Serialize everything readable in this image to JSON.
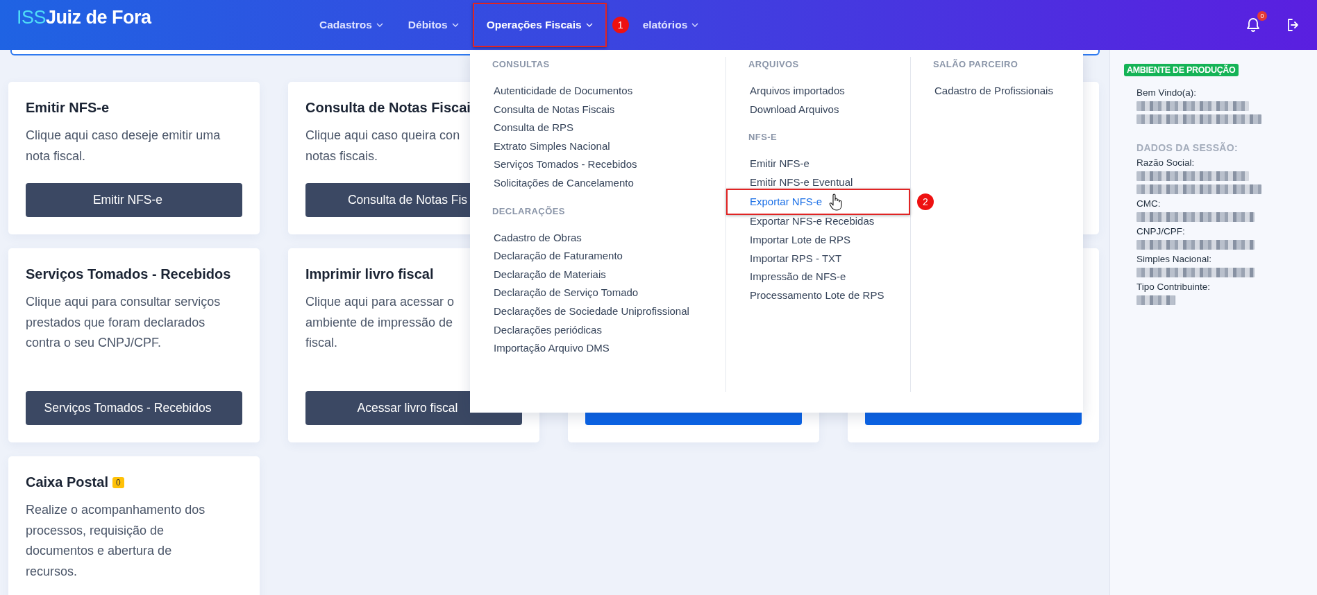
{
  "header": {
    "logo_prefix": "ISS",
    "logo_name": "Juiz de Fora",
    "notification_count": "0",
    "nav": [
      {
        "label": "Cadastros",
        "selected": false
      },
      {
        "label": "Débitos",
        "selected": false
      },
      {
        "label": "Operações Fiscais",
        "selected": true,
        "annotation": "1"
      },
      {
        "label": "elatórios",
        "selected": false
      }
    ]
  },
  "cards": [
    {
      "title": "Emitir NFS-e",
      "lines": [
        "Clique aqui caso deseje emitir uma",
        "nota fiscal."
      ],
      "button": "Emitir NFS-e",
      "kind": "dark"
    },
    {
      "title": "Consulta de Notas Fiscai",
      "lines": [
        "Clique aqui caso queira con",
        "notas fiscais."
      ],
      "button": "Consulta de Notas Fis",
      "kind": "dark"
    },
    {
      "kind": "covered"
    },
    {
      "kind": "plain"
    },
    {
      "title": "Serviços Tomados - Recebidos",
      "lines": [
        "Clique aqui para consultar serviços",
        "prestados que foram declarados",
        "contra o seu CNPJ/CPF."
      ],
      "button": "Serviços Tomados - Recebidos",
      "kind": "dark"
    },
    {
      "title": "Imprimir livro fiscal",
      "lines": [
        "Clique aqui para acessar o",
        "ambiente de impressão de",
        "fiscal."
      ],
      "button": "Acessar livro fiscal",
      "kind": "dark"
    },
    {
      "kind": "primary"
    },
    {
      "kind": "primary"
    },
    {
      "title": "Caixa Postal",
      "badge": "0",
      "lines": [
        "Realize o acompanhamento dos",
        "processos, requisição de",
        "documentos e abertura de",
        "recursos."
      ]
    }
  ],
  "menu": {
    "columns": [
      {
        "sections": [
          {
            "heading": "CONSULTAS",
            "items": [
              {
                "label": "Autenticidade de Documentos",
                "selected": false
              },
              {
                "label": "Consulta de Notas Fiscais",
                "selected": false
              },
              {
                "label": "Consulta de RPS",
                "selected": false
              },
              {
                "label": "Extrato Simples Nacional",
                "selected": false
              },
              {
                "label": "Serviços Tomados - Recebidos",
                "selected": false
              },
              {
                "label": "Solicitações de Cancelamento",
                "selected": false
              }
            ]
          },
          {
            "heading": "DECLARAÇÕES",
            "items": [
              {
                "label": "Cadastro de Obras",
                "selected": false
              },
              {
                "label": "Declaração de Faturamento",
                "selected": false
              },
              {
                "label": "Declaração de Materiais",
                "selected": false
              },
              {
                "label": "Declaração de Serviço Tomado",
                "selected": false
              },
              {
                "label": "Declarações de Sociedade Uniprofissional",
                "selected": false
              },
              {
                "label": "Declarações periódicas",
                "selected": false
              },
              {
                "label": "Importação Arquivo DMS",
                "selected": false
              }
            ]
          }
        ]
      },
      {
        "sections": [
          {
            "heading": "ARQUIVOS",
            "items": [
              {
                "label": "Arquivos importados",
                "selected": false
              },
              {
                "label": "Download Arquivos",
                "selected": false
              }
            ]
          },
          {
            "heading": "NFS-E",
            "items": [
              {
                "label": "Emitir NFS-e",
                "selected": false
              },
              {
                "label": "Emitir NFS-e Eventual",
                "selected": false
              },
              {
                "label": "Exportar NFS-e",
                "selected": true,
                "annotation": "2"
              },
              {
                "label": "Exportar NFS-e Recebidas",
                "selected": false
              },
              {
                "label": "Importar Lote de RPS",
                "selected": false
              },
              {
                "label": "Importar RPS - TXT",
                "selected": false
              },
              {
                "label": "Impressão de NFS-e",
                "selected": false
              },
              {
                "label": "Processamento Lote de RPS",
                "selected": false
              }
            ]
          }
        ]
      },
      {
        "sections": [
          {
            "heading": "SALÃO PARCEIRO",
            "items": [
              {
                "label": "Cadastro de Profissionais",
                "selected": false
              }
            ]
          }
        ]
      }
    ]
  },
  "sidebar": {
    "environment": "AMBIENTE DE PRODUÇÃO",
    "welcome": {
      "label": "Bem Vindo(a):",
      "kind": "two_lines"
    },
    "section_title": "DADOS DA SESSÃO:",
    "fields": [
      {
        "label": "Razão Social:",
        "kind": "two_lines"
      },
      {
        "label": "CMC:",
        "kind": "one_line"
      },
      {
        "label": "CNPJ/CPF:",
        "kind": "one_line"
      },
      {
        "label": "Simples Nacional:",
        "kind": "one_line"
      },
      {
        "label": "Tipo Contribuinte:",
        "kind": "short_line"
      }
    ]
  }
}
